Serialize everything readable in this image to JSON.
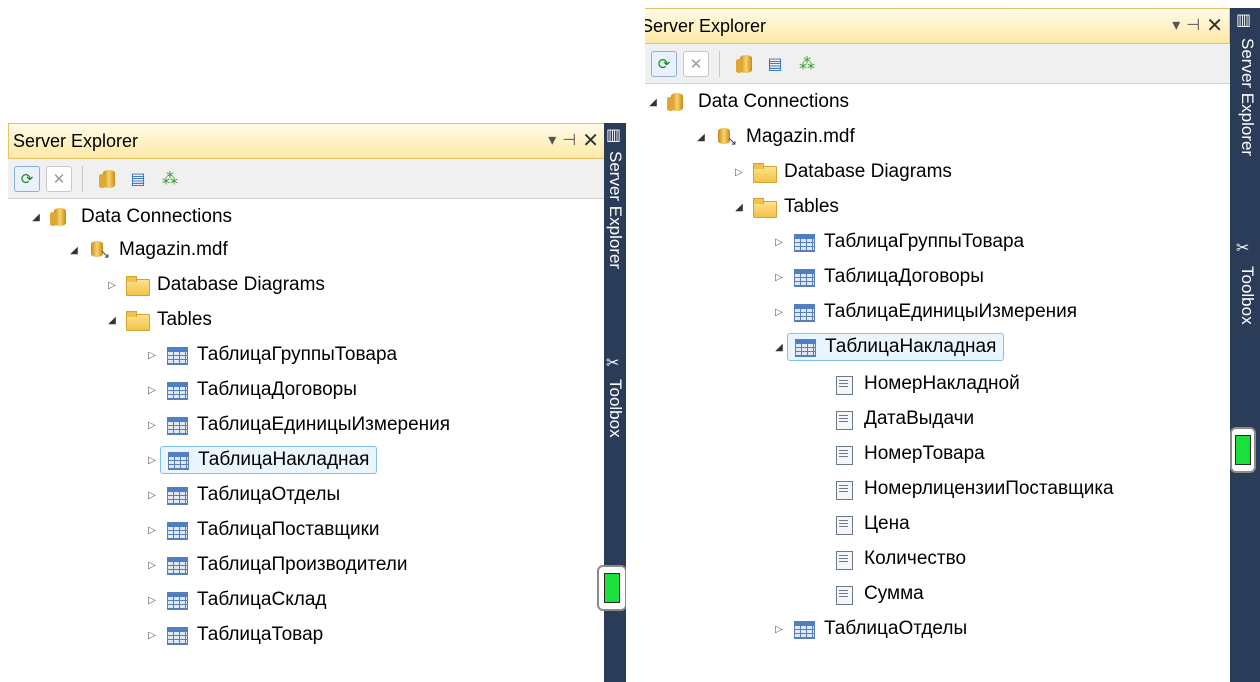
{
  "title": "Server Explorer",
  "title_controls": [
    "▾",
    "⊣",
    "✕"
  ],
  "side_tabs": [
    "Server Explorer",
    "Toolbox"
  ],
  "colors": {
    "rail": "#2b3c58",
    "title_gradient": "#fde9a6",
    "indicator": "#19e03a",
    "selection_border": "#7fc2f0"
  },
  "left": {
    "tree": {
      "root": "Data Connections",
      "db": "Magazin.mdf",
      "diagrams": "Database Diagrams",
      "tables_folder": "Tables",
      "tables": [
        "ТаблицаГруппыТовара",
        "ТаблицаДоговоры",
        "ТаблицаЕдиницыИзмерения",
        "ТаблицаНакладная",
        "ТаблицаОтделы",
        "ТаблицаПоставщики",
        "ТаблицаПроизводители",
        "ТаблицаСклад",
        "ТаблицаТовар"
      ]
    }
  },
  "right": {
    "tree": {
      "root": "Data Connections",
      "db": "Magazin.mdf",
      "diagrams": "Database Diagrams",
      "tables_folder": "Tables",
      "tables_before": [
        "ТаблицаГруппыТовара",
        "ТаблицаДоговоры",
        "ТаблицаЕдиницыИзмерения"
      ],
      "expanded_table": "ТаблицаНакладная",
      "columns": [
        "НомерНакладной",
        "ДатаВыдачи",
        "НомерТовара",
        "НомерлицензииПоставщика",
        "Цена",
        "Количество",
        "Сумма"
      ],
      "tables_after": [
        "ТаблицаОтделы"
      ]
    }
  }
}
